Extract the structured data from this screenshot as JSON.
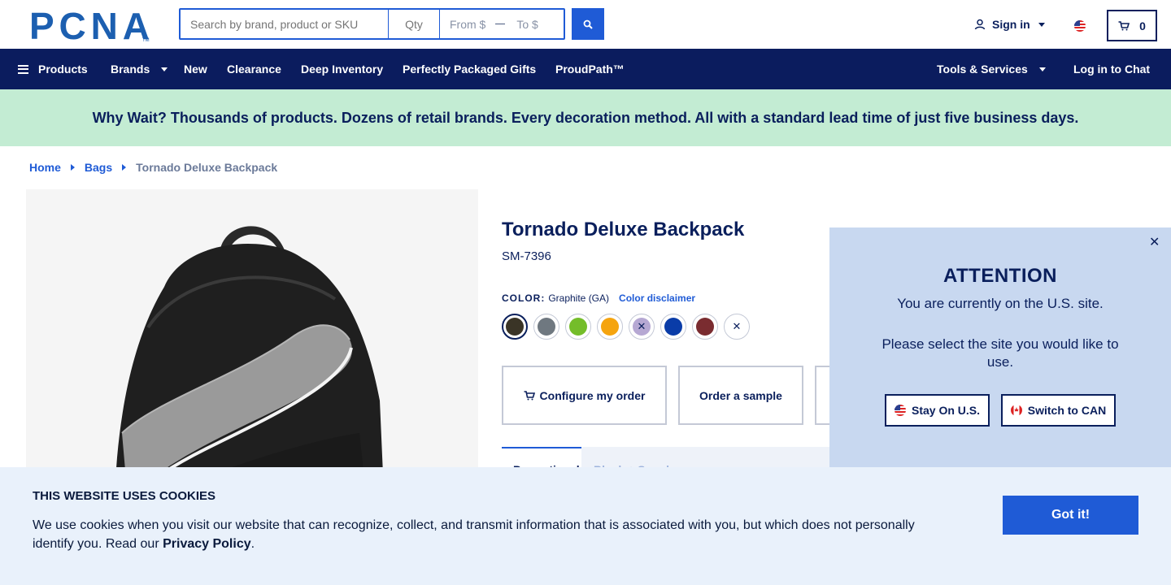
{
  "header": {
    "search_placeholder": "Search by brand, product or SKU",
    "qty_placeholder": "Qty",
    "from_placeholder": "From $",
    "to_placeholder": "To $",
    "sign_in": "Sign in",
    "cart_count": "0"
  },
  "nav": {
    "products": "Products",
    "brands": "Brands",
    "new": "New",
    "clearance": "Clearance",
    "deep_inventory": "Deep Inventory",
    "gifts": "Perfectly Packaged Gifts",
    "proudpath": "ProudPath™",
    "tools": "Tools & Services",
    "chat": "Log in to Chat"
  },
  "banner": {
    "text": "Why Wait? Thousands of products. Dozens of retail brands. Every decoration method. All with a standard lead time of just five business days."
  },
  "breadcrumb": {
    "items": [
      "Home",
      "Bags",
      "Tornado Deluxe Backpack"
    ]
  },
  "product": {
    "title": "Tornado Deluxe Backpack",
    "sku": "SM-7396",
    "color_label": "COLOR:",
    "color_value": "Graphite (GA)",
    "color_disclaimer": "Color disclaimer",
    "swatches": [
      "#3a3426",
      "#6f7880",
      "#74bd2a",
      "#f5a40f",
      "#b6a8d3",
      "#0a3ca8",
      "#7a2c30",
      "#ffffff"
    ],
    "configure": "Configure my order",
    "sample": "Order a sample",
    "tab1": "Promotional",
    "tab2": "Blank + Supply"
  },
  "modal": {
    "title": "ATTENTION",
    "text1": "You are currently on the U.S. site.",
    "text2": "Please select the site you would like to use.",
    "stay": "Stay On U.S.",
    "switch": "Switch to CAN"
  },
  "cookie": {
    "title": "THIS WEBSITE USES COOKIES",
    "text": "We use cookies when you visit our website that can recognize, collect, and transmit information that is associated with you, but which does not personally identify you. Read our ",
    "link": "Privacy Policy",
    "end": ".",
    "button": "Got it!"
  }
}
